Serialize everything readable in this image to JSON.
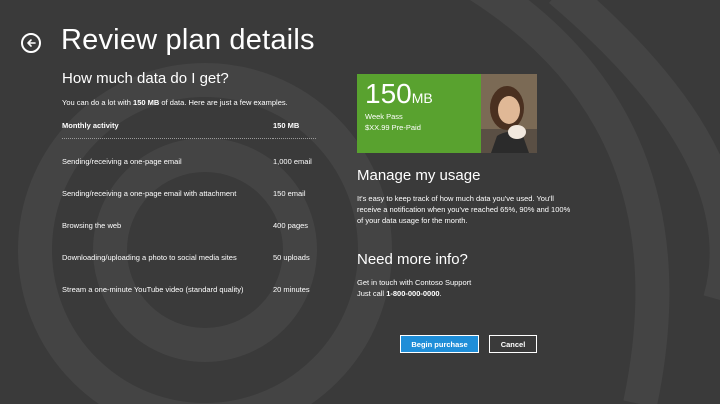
{
  "page": {
    "title": "Review plan details",
    "back_icon": "back-arrow-icon",
    "colors": {
      "background": "#3a3a3a",
      "promo_green": "#59a22f",
      "primary_button": "#1f8ed8"
    }
  },
  "data_section": {
    "heading": "How much data do I get?",
    "intro_prefix": "You can do a lot with ",
    "intro_bold": "150 MB",
    "intro_suffix": " of data. Here are just a few examples.",
    "table": {
      "headers": [
        "Monthly activity",
        "150 MB"
      ],
      "rows": [
        {
          "activity": "Sending/receiving a one-page email",
          "amount": "1,000 email"
        },
        {
          "activity": "Sending/receiving a one-page email with attachment",
          "amount": "150 email"
        },
        {
          "activity": "Browsing the web",
          "amount": "400 pages"
        },
        {
          "activity": "Downloading/uploading a photo to social media sites",
          "amount": "50 uploads"
        },
        {
          "activity": "Stream a one-minute YouTube video (standard quality)",
          "amount": "20 minutes"
        }
      ]
    }
  },
  "promo": {
    "size_number": "150",
    "size_unit": "MB",
    "plan_name": "Week Pass",
    "price": "$XX.99 Pre-Paid"
  },
  "manage": {
    "heading": "Manage my usage",
    "body": "It's easy to keep track of how much data you've used. You'll receive a notification when you've reached 65%, 90% and 100% of your data usage for the month."
  },
  "info": {
    "heading": "Need more info?",
    "line1": "Get in touch with Contoso Support",
    "line2_prefix": "Just call ",
    "phone": "1-800-000-0000",
    "line2_suffix": "."
  },
  "actions": {
    "primary": "Begin purchase",
    "secondary": "Cancel"
  }
}
